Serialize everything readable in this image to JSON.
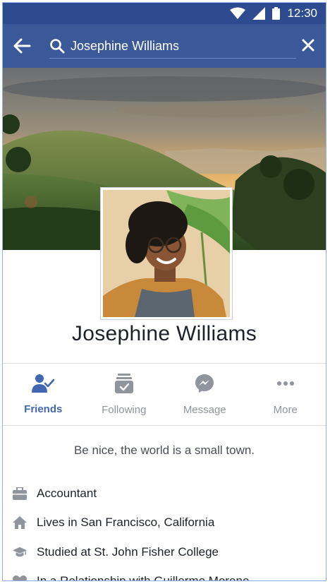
{
  "status_bar": {
    "time": "12:30",
    "icons": [
      "wifi-icon",
      "signal-icon",
      "battery-icon"
    ]
  },
  "app_bar": {
    "back_icon": "back-arrow-icon",
    "search_value": "Josephine Williams",
    "search_icon": "search-icon",
    "clear_icon": "close-icon",
    "color": "#3b5998"
  },
  "profile": {
    "name": "Josephine Williams",
    "bio": "Be nice, the world is a small town."
  },
  "actions": [
    {
      "label": "Friends",
      "icon": "friends-check-icon",
      "active": true
    },
    {
      "label": "Following",
      "icon": "following-icon",
      "active": false
    },
    {
      "label": "Message",
      "icon": "messenger-icon",
      "active": false
    },
    {
      "label": "More",
      "icon": "more-dots-icon",
      "active": false
    }
  ],
  "info": [
    {
      "icon": "briefcase-icon",
      "text": "Accountant"
    },
    {
      "icon": "home-icon",
      "text": "Lives in San Francisco, California"
    },
    {
      "icon": "graduation-cap-icon",
      "text": "Studied at St. John Fisher College"
    },
    {
      "icon": "heart-icon",
      "text": "In a Relationship with Guillermo Moreno"
    }
  ],
  "colors": {
    "accent": "#4267b2",
    "status_bar": "#2f4b8f",
    "muted_icon": "#90949c"
  }
}
